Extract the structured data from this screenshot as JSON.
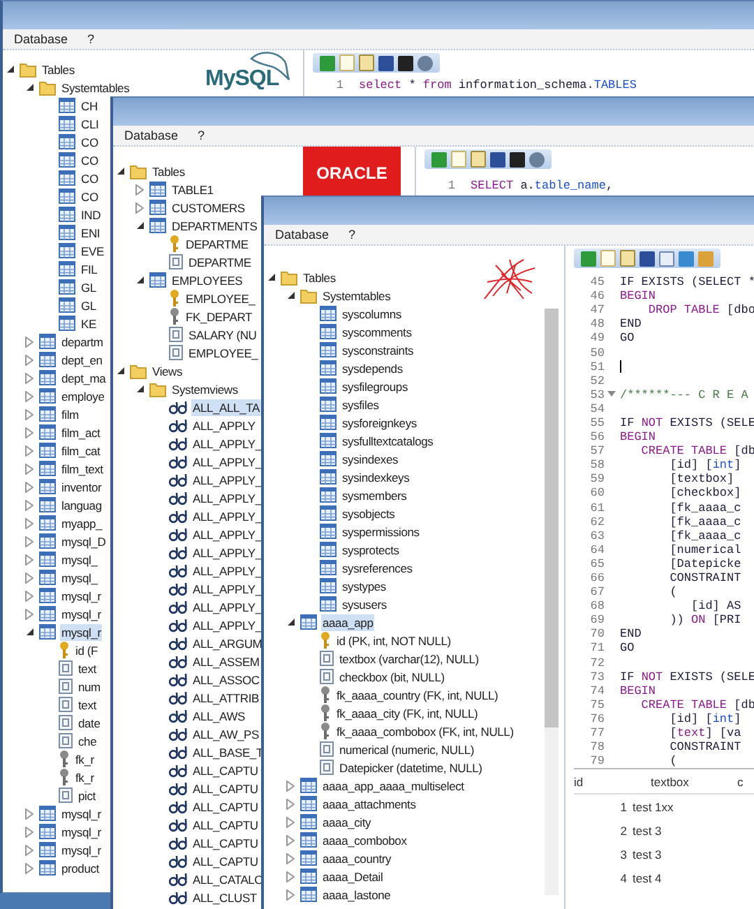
{
  "windows": [
    {
      "menu": [
        "Database",
        "?"
      ],
      "logo": {
        "kind": "mysql",
        "text": "MySQL"
      },
      "tree": [
        {
          "label": "Tables",
          "kind": "folder",
          "expanded": true,
          "selected": false,
          "children": [
            {
              "label": "Systemtables",
              "kind": "folder",
              "expanded": true,
              "selected": false,
              "children": [
                {
                  "label": "CH",
                  "kind": "table",
                  "selected": false
                },
                {
                  "label": "CLI",
                  "kind": "table",
                  "selected": false
                },
                {
                  "label": "CO",
                  "kind": "table",
                  "selected": false
                },
                {
                  "label": "CO",
                  "kind": "table",
                  "selected": false
                },
                {
                  "label": "CO",
                  "kind": "table",
                  "selected": false
                },
                {
                  "label": "CO",
                  "kind": "table",
                  "selected": false
                },
                {
                  "label": "IND",
                  "kind": "table",
                  "selected": false
                },
                {
                  "label": "ENI",
                  "kind": "table",
                  "selected": false
                },
                {
                  "label": "EVE",
                  "kind": "table",
                  "selected": false
                },
                {
                  "label": "FIL",
                  "kind": "table",
                  "selected": false
                },
                {
                  "label": "GL",
                  "kind": "table",
                  "selected": false
                },
                {
                  "label": "GL",
                  "kind": "table",
                  "selected": false
                },
                {
                  "label": "KE",
                  "kind": "table",
                  "selected": false
                }
              ]
            },
            {
              "label": "departm",
              "kind": "table",
              "expanded": false,
              "selected": false
            },
            {
              "label": "dept_en",
              "kind": "table",
              "expanded": false,
              "selected": false
            },
            {
              "label": "dept_ma",
              "kind": "table",
              "expanded": false,
              "selected": false
            },
            {
              "label": "employe",
              "kind": "table",
              "expanded": false,
              "selected": false
            },
            {
              "label": "film",
              "kind": "table",
              "expanded": false,
              "selected": false
            },
            {
              "label": "film_act",
              "kind": "table",
              "expanded": false,
              "selected": false
            },
            {
              "label": "film_cat",
              "kind": "table",
              "expanded": false,
              "selected": false
            },
            {
              "label": "film_text",
              "kind": "table",
              "expanded": false,
              "selected": false
            },
            {
              "label": "inventor",
              "kind": "table",
              "expanded": false,
              "selected": false
            },
            {
              "label": "languag",
              "kind": "table",
              "expanded": false,
              "selected": false
            },
            {
              "label": "myapp_",
              "kind": "table",
              "expanded": false,
              "selected": false
            },
            {
              "label": "mysql_D",
              "kind": "table",
              "expanded": false,
              "selected": false
            },
            {
              "label": "mysql_",
              "kind": "table",
              "expanded": false,
              "selected": false
            },
            {
              "label": "mysql_",
              "kind": "table",
              "expanded": false,
              "selected": false
            },
            {
              "label": "mysql_r",
              "kind": "table",
              "expanded": false,
              "selected": false
            },
            {
              "label": "mysql_r",
              "kind": "table",
              "expanded": false,
              "selected": false
            },
            {
              "label": "mysql_r",
              "kind": "table",
              "expanded": true,
              "selected": true,
              "children": [
                {
                  "label": "id (F",
                  "kind": "key",
                  "selected": false
                },
                {
                  "label": "text",
                  "kind": "column",
                  "selected": false
                },
                {
                  "label": "num",
                  "kind": "column",
                  "selected": false
                },
                {
                  "label": "text",
                  "kind": "column",
                  "selected": false
                },
                {
                  "label": "date",
                  "kind": "column",
                  "selected": false
                },
                {
                  "label": "che",
                  "kind": "column",
                  "selected": false
                },
                {
                  "label": "fk_r",
                  "kind": "fk",
                  "selected": false
                },
                {
                  "label": "fk_r",
                  "kind": "fk",
                  "selected": false
                },
                {
                  "label": "pict",
                  "kind": "column",
                  "selected": false
                }
              ]
            },
            {
              "label": "mysql_r",
              "kind": "table",
              "expanded": false,
              "selected": false
            },
            {
              "label": "mysql_r",
              "kind": "table",
              "expanded": false,
              "selected": false
            },
            {
              "label": "mysql_r",
              "kind": "table",
              "expanded": false,
              "selected": false
            },
            {
              "label": "product",
              "kind": "table",
              "expanded": false,
              "selected": false
            }
          ]
        }
      ],
      "lines": [
        {
          "no": "1",
          "parts": [
            {
              "kind": "keyword",
              "text": "select"
            },
            {
              "kind": "plain",
              "text": " * "
            },
            {
              "kind": "keyword",
              "text": "from"
            },
            {
              "kind": "plain",
              "text": " information_schema."
            },
            {
              "kind": "type",
              "text": "TABLES"
            }
          ]
        }
      ]
    },
    {
      "menu": [
        "Database",
        "?"
      ],
      "logo": {
        "kind": "oracle",
        "text": "ORACLE"
      },
      "tree": [
        {
          "label": "Tables",
          "kind": "folder",
          "expanded": true,
          "selected": false,
          "children": [
            {
              "label": "TABLE1",
              "kind": "table",
              "expanded": false,
              "selected": false
            },
            {
              "label": "CUSTOMERS",
              "kind": "table",
              "expanded": false,
              "selected": false
            },
            {
              "label": "DEPARTMENTS",
              "kind": "table",
              "expanded": true,
              "selected": false,
              "children": [
                {
                  "label": "DEPARTME",
                  "kind": "key",
                  "selected": false
                },
                {
                  "label": "DEPARTME",
                  "kind": "column",
                  "selected": false
                }
              ]
            },
            {
              "label": "EMPLOYEES",
              "kind": "table",
              "expanded": true,
              "selected": false,
              "children": [
                {
                  "label": "EMPLOYEE_",
                  "kind": "key",
                  "selected": false
                },
                {
                  "label": "FK_DEPART",
                  "kind": "fk",
                  "selected": false
                },
                {
                  "label": "SALARY (NU",
                  "kind": "column",
                  "selected": false
                },
                {
                  "label": "EMPLOYEE_",
                  "kind": "column",
                  "selected": false
                }
              ]
            }
          ]
        },
        {
          "label": "Views",
          "kind": "folder",
          "expanded": true,
          "selected": false,
          "children": [
            {
              "label": "Systemviews",
              "kind": "folder",
              "expanded": true,
              "selected": false,
              "children": [
                {
                  "label": "ALL_ALL_TA",
                  "kind": "view",
                  "selected": true
                },
                {
                  "label": "ALL_APPLY",
                  "kind": "view",
                  "selected": false
                },
                {
                  "label": "ALL_APPLY_",
                  "kind": "view",
                  "selected": false
                },
                {
                  "label": "ALL_APPLY_",
                  "kind": "view",
                  "selected": false
                },
                {
                  "label": "ALL_APPLY_",
                  "kind": "view",
                  "selected": false
                },
                {
                  "label": "ALL_APPLY_",
                  "kind": "view",
                  "selected": false
                },
                {
                  "label": "ALL_APPLY_",
                  "kind": "view",
                  "selected": false
                },
                {
                  "label": "ALL_APPLY_",
                  "kind": "view",
                  "selected": false
                },
                {
                  "label": "ALL_APPLY_",
                  "kind": "view",
                  "selected": false
                },
                {
                  "label": "ALL_APPLY_",
                  "kind": "view",
                  "selected": false
                },
                {
                  "label": "ALL_APPLY_",
                  "kind": "view",
                  "selected": false
                },
                {
                  "label": "ALL_APPLY_",
                  "kind": "view",
                  "selected": false
                },
                {
                  "label": "ALL_APPLY_",
                  "kind": "view",
                  "selected": false
                },
                {
                  "label": "ALL_ARGUM",
                  "kind": "view",
                  "selected": false
                },
                {
                  "label": "ALL_ASSEM",
                  "kind": "view",
                  "selected": false
                },
                {
                  "label": "ALL_ASSOC",
                  "kind": "view",
                  "selected": false
                },
                {
                  "label": "ALL_ATTRIB",
                  "kind": "view",
                  "selected": false
                },
                {
                  "label": "ALL_AWS",
                  "kind": "view",
                  "selected": false
                },
                {
                  "label": "ALL_AW_PS",
                  "kind": "view",
                  "selected": false
                },
                {
                  "label": "ALL_BASE_T",
                  "kind": "view",
                  "selected": false
                },
                {
                  "label": "ALL_CAPTU",
                  "kind": "view",
                  "selected": false
                },
                {
                  "label": "ALL_CAPTU",
                  "kind": "view",
                  "selected": false
                },
                {
                  "label": "ALL_CAPTU",
                  "kind": "view",
                  "selected": false
                },
                {
                  "label": "ALL_CAPTU",
                  "kind": "view",
                  "selected": false
                },
                {
                  "label": "ALL_CAPTU",
                  "kind": "view",
                  "selected": false
                },
                {
                  "label": "ALL_CAPTU",
                  "kind": "view",
                  "selected": false
                },
                {
                  "label": "ALL_CATALO",
                  "kind": "view",
                  "selected": false
                },
                {
                  "label": "ALL_CLUST",
                  "kind": "view",
                  "selected": false
                }
              ]
            }
          ]
        }
      ],
      "lines": [
        {
          "no": "1",
          "parts": [
            {
              "kind": "keyword",
              "text": "SELECT"
            },
            {
              "kind": "plain",
              "text": " a."
            },
            {
              "kind": "type",
              "text": "table_name"
            },
            {
              "kind": "plain",
              "text": ","
            }
          ]
        }
      ]
    },
    {
      "menu": [
        "Database",
        "?"
      ],
      "logo": {
        "kind": "sqlserver"
      },
      "tree": [
        {
          "label": "Tables",
          "kind": "folder",
          "expanded": true,
          "selected": false,
          "children": [
            {
              "label": "Systemtables",
              "kind": "folder",
              "expanded": true,
              "selected": false,
              "children": [
                {
                  "label": "syscolumns",
                  "kind": "table",
                  "selected": false
                },
                {
                  "label": "syscomments",
                  "kind": "table",
                  "selected": false
                },
                {
                  "label": "sysconstraints",
                  "kind": "table",
                  "selected": false
                },
                {
                  "label": "sysdepends",
                  "kind": "table",
                  "selected": false
                },
                {
                  "label": "sysfilegroups",
                  "kind": "table",
                  "selected": false
                },
                {
                  "label": "sysfiles",
                  "kind": "table",
                  "selected": false
                },
                {
                  "label": "sysforeignkeys",
                  "kind": "table",
                  "selected": false
                },
                {
                  "label": "sysfulltextcatalogs",
                  "kind": "table",
                  "selected": false
                },
                {
                  "label": "sysindexes",
                  "kind": "table",
                  "selected": false
                },
                {
                  "label": "sysindexkeys",
                  "kind": "table",
                  "selected": false
                },
                {
                  "label": "sysmembers",
                  "kind": "table",
                  "selected": false
                },
                {
                  "label": "sysobjects",
                  "kind": "table",
                  "selected": false
                },
                {
                  "label": "syspermissions",
                  "kind": "table",
                  "selected": false
                },
                {
                  "label": "sysprotects",
                  "kind": "table",
                  "selected": false
                },
                {
                  "label": "sysreferences",
                  "kind": "table",
                  "selected": false
                },
                {
                  "label": "systypes",
                  "kind": "table",
                  "selected": false
                },
                {
                  "label": "sysusers",
                  "kind": "table",
                  "selected": false
                }
              ]
            },
            {
              "label": "aaaa_app",
              "kind": "table",
              "expanded": true,
              "selected": true,
              "children": [
                {
                  "label": "id (PK, int, NOT NULL)",
                  "kind": "key",
                  "selected": false
                },
                {
                  "label": "textbox (varchar(12), NULL)",
                  "kind": "column",
                  "selected": false
                },
                {
                  "label": "checkbox (bit, NULL)",
                  "kind": "column",
                  "selected": false
                },
                {
                  "label": "fk_aaaa_country (FK, int, NULL)",
                  "kind": "fk",
                  "selected": false
                },
                {
                  "label": "fk_aaaa_city (FK, int, NULL)",
                  "kind": "fk",
                  "selected": false
                },
                {
                  "label": "fk_aaaa_combobox (FK, int, NULL)",
                  "kind": "fk",
                  "selected": false
                },
                {
                  "label": "numerical (numeric, NULL)",
                  "kind": "column",
                  "selected": false
                },
                {
                  "label": "Datepicker (datetime, NULL)",
                  "kind": "column",
                  "selected": false
                }
              ]
            },
            {
              "label": "aaaa_app_aaaa_multiselect",
              "kind": "table",
              "expanded": false,
              "selected": false
            },
            {
              "label": "aaaa_attachments",
              "kind": "table",
              "expanded": false,
              "selected": false
            },
            {
              "label": "aaaa_city",
              "kind": "table",
              "expanded": false,
              "selected": false
            },
            {
              "label": "aaaa_combobox",
              "kind": "table",
              "expanded": false,
              "selected": false
            },
            {
              "label": "aaaa_country",
              "kind": "table",
              "expanded": false,
              "selected": false
            },
            {
              "label": "aaaa_Detail",
              "kind": "table",
              "expanded": false,
              "selected": false
            },
            {
              "label": "aaaa_lastone",
              "kind": "table",
              "expanded": false,
              "selected": false
            }
          ]
        }
      ],
      "lines": [
        {
          "no": "45",
          "parts": [
            {
              "kind": "plain",
              "text": "IF EXISTS (SELECT *"
            }
          ]
        },
        {
          "no": "46",
          "parts": [
            {
              "kind": "keyword",
              "text": "BEGIN"
            }
          ]
        },
        {
          "no": "47",
          "parts": [
            {
              "kind": "keyword",
              "text": "    DROP TABLE"
            },
            {
              "kind": "plain",
              "text": " [dbo"
            }
          ]
        },
        {
          "no": "48",
          "parts": [
            {
              "kind": "plain",
              "text": "END"
            }
          ]
        },
        {
          "no": "49",
          "parts": [
            {
              "kind": "plain",
              "text": "GO"
            }
          ]
        },
        {
          "no": "50"
        },
        {
          "no": "51",
          "cursor": true
        },
        {
          "no": "52"
        },
        {
          "no": "53",
          "parts": [
            {
              "kind": "comment",
              "text": "/******--- C R E A"
            }
          ],
          "fold": true
        },
        {
          "no": "54"
        },
        {
          "no": "55",
          "parts": [
            {
              "kind": "plain",
              "text": "IF "
            },
            {
              "kind": "keyword",
              "text": "NOT"
            },
            {
              "kind": "plain",
              "text": " EXISTS (SELE"
            }
          ]
        },
        {
          "no": "56",
          "parts": [
            {
              "kind": "keyword",
              "text": "BEGIN"
            }
          ]
        },
        {
          "no": "57",
          "parts": [
            {
              "kind": "keyword",
              "text": "   CREATE TABLE"
            },
            {
              "kind": "plain",
              "text": " [db"
            }
          ]
        },
        {
          "no": "58",
          "parts": [
            {
              "kind": "plain",
              "text": "       [id] ["
            },
            {
              "kind": "type",
              "text": "int"
            },
            {
              "kind": "plain",
              "text": "]"
            }
          ]
        },
        {
          "no": "59",
          "parts": [
            {
              "kind": "plain",
              "text": "       [textbox]"
            }
          ]
        },
        {
          "no": "60",
          "parts": [
            {
              "kind": "plain",
              "text": "       [checkbox]"
            }
          ]
        },
        {
          "no": "61",
          "parts": [
            {
              "kind": "plain",
              "text": "       [fk_aaaa_c"
            }
          ]
        },
        {
          "no": "62",
          "parts": [
            {
              "kind": "plain",
              "text": "       [fk_aaaa_c"
            }
          ]
        },
        {
          "no": "63",
          "parts": [
            {
              "kind": "plain",
              "text": "       [fk_aaaa_c"
            }
          ]
        },
        {
          "no": "64",
          "parts": [
            {
              "kind": "plain",
              "text": "       [numerical"
            }
          ]
        },
        {
          "no": "65",
          "parts": [
            {
              "kind": "plain",
              "text": "       [Datepicke"
            }
          ]
        },
        {
          "no": "66",
          "parts": [
            {
              "kind": "plain",
              "text": "       CONSTRAINT"
            }
          ]
        },
        {
          "no": "67",
          "parts": [
            {
              "kind": "plain",
              "text": "       ("
            }
          ]
        },
        {
          "no": "68",
          "parts": [
            {
              "kind": "plain",
              "text": "          [id] AS"
            }
          ]
        },
        {
          "no": "69",
          "parts": [
            {
              "kind": "plain",
              "text": "       )) "
            },
            {
              "kind": "keyword",
              "text": "ON"
            },
            {
              "kind": "plain",
              "text": " [PRI"
            }
          ]
        },
        {
          "no": "70",
          "parts": [
            {
              "kind": "plain",
              "text": "END"
            }
          ]
        },
        {
          "no": "71",
          "parts": [
            {
              "kind": "plain",
              "text": "GO"
            }
          ]
        },
        {
          "no": "72"
        },
        {
          "no": "73",
          "parts": [
            {
              "kind": "plain",
              "text": "IF "
            },
            {
              "kind": "keyword",
              "text": "NOT"
            },
            {
              "kind": "plain",
              "text": " EXISTS (SELE"
            }
          ]
        },
        {
          "no": "74",
          "parts": [
            {
              "kind": "keyword",
              "text": "BEGIN"
            }
          ]
        },
        {
          "no": "75",
          "parts": [
            {
              "kind": "keyword",
              "text": "   CREATE TABLE"
            },
            {
              "kind": "plain",
              "text": " [db"
            }
          ]
        },
        {
          "no": "76",
          "parts": [
            {
              "kind": "plain",
              "text": "       [id] ["
            },
            {
              "kind": "type",
              "text": "int"
            },
            {
              "kind": "plain",
              "text": "]"
            }
          ]
        },
        {
          "no": "77",
          "parts": [
            {
              "kind": "plain",
              "text": "       ["
            },
            {
              "kind": "keyword",
              "text": "text"
            },
            {
              "kind": "plain",
              "text": "] [va"
            }
          ]
        },
        {
          "no": "78",
          "parts": [
            {
              "kind": "plain",
              "text": "       CONSTRAINT"
            }
          ]
        },
        {
          "no": "79",
          "parts": [
            {
              "kind": "plain",
              "text": "       ("
            }
          ]
        }
      ],
      "results": {
        "columns": [
          "id",
          "textbox",
          "c"
        ],
        "rows": [
          [
            "1",
            "test 1xx"
          ],
          [
            "2",
            "test 3"
          ],
          [
            "3",
            "test 3"
          ],
          [
            "4",
            "test 4"
          ]
        ]
      }
    }
  ]
}
